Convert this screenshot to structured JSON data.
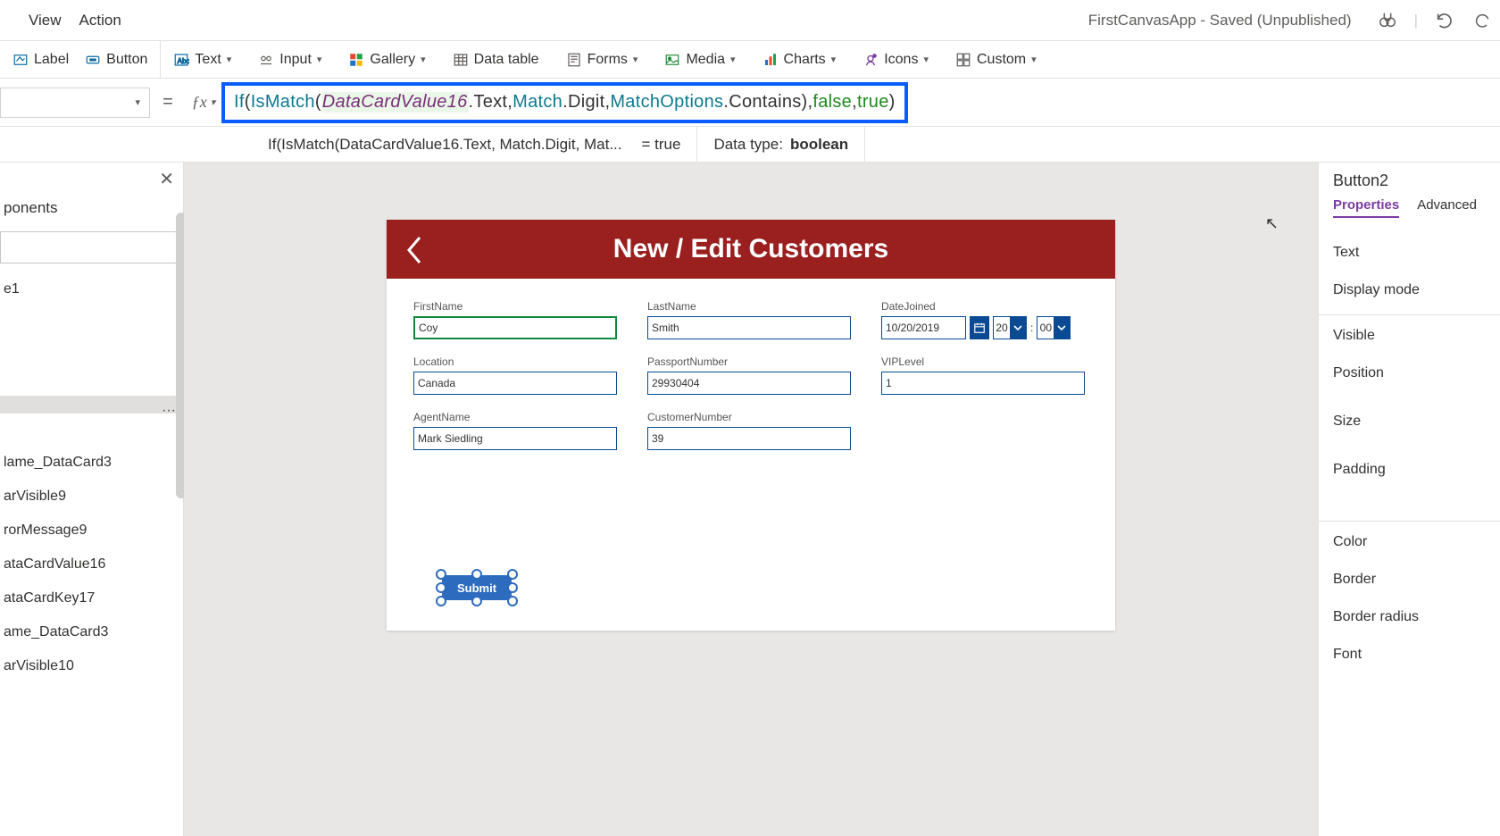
{
  "menubar": {
    "view": "View",
    "action": "Action",
    "appstatus": "FirstCanvasApp - Saved (Unpublished)"
  },
  "ribbon": {
    "label": "Label",
    "button": "Button",
    "text": "Text",
    "input": "Input",
    "gallery": "Gallery",
    "datatable": "Data table",
    "forms": "Forms",
    "media": "Media",
    "charts": "Charts",
    "icons": "Icons",
    "custom": "Custom"
  },
  "formula": {
    "tokens": {
      "if": "If",
      "ismatch": "IsMatch",
      "dcv": "DataCardValue16",
      "text": ".Text, ",
      "match": "Match",
      "digit": ".Digit, ",
      "mopts": "MatchOptions",
      "contains": ".Contains), ",
      "false": "false",
      "comma2": ", ",
      "true": "true",
      "close": ")"
    },
    "preview": "If(IsMatch(DataCardValue16.Text, Match.Digit, Mat...",
    "eqtrue": "=  true",
    "datatype_label": "Data type: ",
    "datatype_value": "boolean"
  },
  "tree": {
    "tab": "ponents",
    "item_e1": "e1",
    "selected_blank": " ",
    "items": [
      "lame_DataCard3",
      "arVisible9",
      "rorMessage9",
      "ataCardValue16",
      "ataCardKey17",
      "ame_DataCard3",
      "arVisible10"
    ]
  },
  "canvas": {
    "title": "New / Edit Customers",
    "labels": {
      "firstname": "FirstName",
      "lastname": "LastName",
      "datejoined": "DateJoined",
      "location": "Location",
      "passport": "PassportNumber",
      "vip": "VIPLevel",
      "agent": "AgentName",
      "custno": "CustomerNumber"
    },
    "values": {
      "firstname": "Coy",
      "lastname": "Smith",
      "date": "10/20/2019",
      "hour": "20",
      "min": "00",
      "location": "Canada",
      "passport": "29930404",
      "vip": "1",
      "agent": "Mark Siedling",
      "custno": "39",
      "colon": ":"
    },
    "submit": "Submit"
  },
  "properties": {
    "selected": "Button2",
    "tab_properties": "Properties",
    "tab_advanced": "Advanced",
    "rows": {
      "text": "Text",
      "displaymode": "Display mode",
      "visible": "Visible",
      "position": "Position",
      "size": "Size",
      "padding": "Padding",
      "color": "Color",
      "border": "Border",
      "borderradius": "Border radius",
      "font": "Font"
    }
  }
}
